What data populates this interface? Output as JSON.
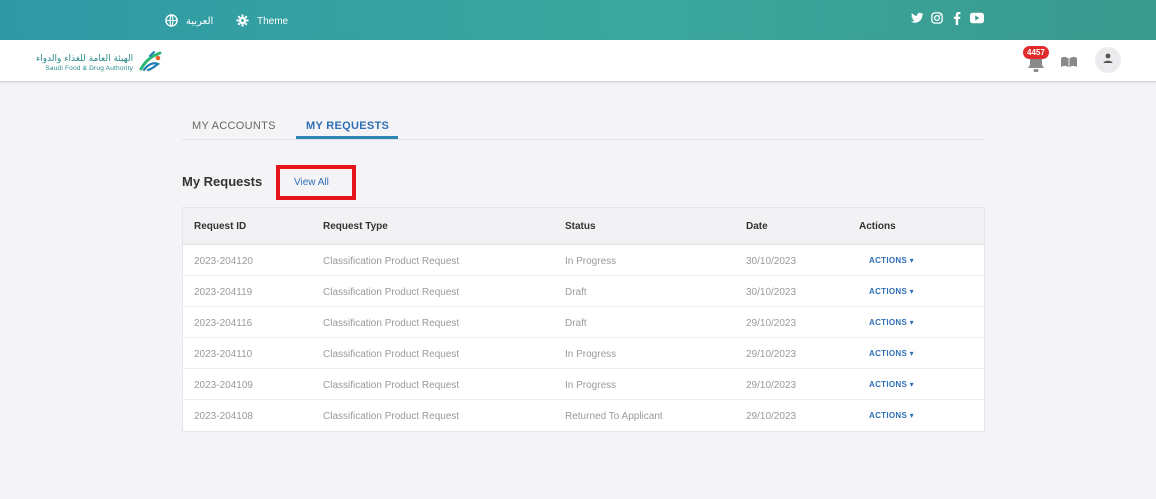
{
  "topbar": {
    "language_label": "العربية",
    "theme_label": "Theme",
    "socials": [
      "twitter-icon",
      "instagram-icon",
      "facebook-icon",
      "youtube-icon"
    ],
    "gradient_start": "#2f9aa6",
    "gradient_end": "#3a9a8e"
  },
  "header": {
    "logo_arabic": "الهيئة العامة للغذاء والدواء",
    "logo_english": "Saudi Food & Drug Authority",
    "notification_count": "4457"
  },
  "tabs": [
    {
      "label": "MY ACCOUNTS",
      "active": false
    },
    {
      "label": "MY REQUESTS",
      "active": true
    }
  ],
  "section": {
    "title": "My Requests",
    "view_all": "View All",
    "highlight_color": "#e8141b"
  },
  "table": {
    "headers": [
      "Request ID",
      "Request Type",
      "Status",
      "Date",
      "Actions"
    ],
    "action_label": "ACTIONS ▾",
    "rows": [
      [
        "2023-204120",
        "Classification Product Request",
        "In Progress",
        "30/10/2023"
      ],
      [
        "2023-204119",
        "Classification Product Request",
        "Draft",
        "30/10/2023"
      ],
      [
        "2023-204116",
        "Classification Product Request",
        "Draft",
        "29/10/2023"
      ],
      [
        "2023-204110",
        "Classification Product Request",
        "In Progress",
        "29/10/2023"
      ],
      [
        "2023-204109",
        "Classification Product Request",
        "In Progress",
        "29/10/2023"
      ],
      [
        "2023-204108",
        "Classification Product Request",
        "Returned To Applicant",
        "29/10/2023"
      ]
    ]
  },
  "colors": {
    "accent": "#2f6fb5",
    "badge": "#e02c2c"
  }
}
